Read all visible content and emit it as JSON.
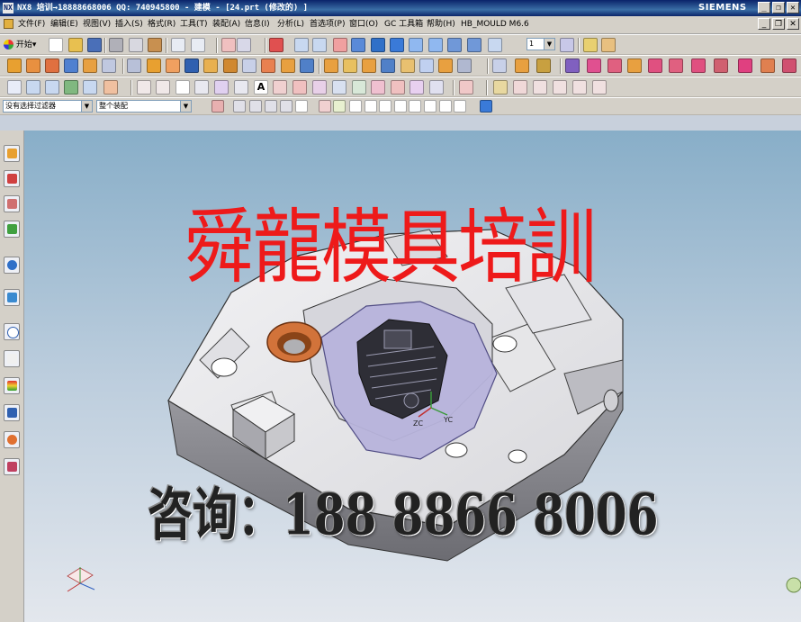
{
  "window": {
    "title": "NX8 培训→18888668006 QQ: 740945800 - 建模 - [24.prt (修改的) ]",
    "app_icon": "NX",
    "brand": "SIEMENS"
  },
  "menubar": {
    "items": [
      "文件(F)",
      "编辑(E)",
      "视图(V)",
      "插入(S)",
      "格式(R)",
      "工具(T)",
      "装配(A)",
      "信息(I)",
      "分析(L)",
      "首选项(P)",
      "窗口(O)",
      "GC 工具箱",
      "帮助(H)",
      "HB_MOULD M6.6"
    ]
  },
  "toolbar1": {
    "start_label": "开始",
    "layer_value": "1"
  },
  "selection_bar": {
    "filter_value": "没有选择过滤器",
    "scope_value": "整个装配"
  },
  "viewport": {
    "watermark": "舜龍模具培訓",
    "contact": "咨询：188 8866 8006",
    "triad_labels": {
      "zc": "ZC",
      "yc": "YC"
    }
  },
  "colors": {
    "title_bar": "#0a246a",
    "toolbar_bg": "#d4d0c8",
    "viewport_top": "#88aec8",
    "viewport_bottom": "#e3e7ed",
    "watermark": "#ee1a1a",
    "mold_plate": "#e8e8ea",
    "core_insert": "#b8b4dc",
    "bushing": "#d2733a"
  }
}
